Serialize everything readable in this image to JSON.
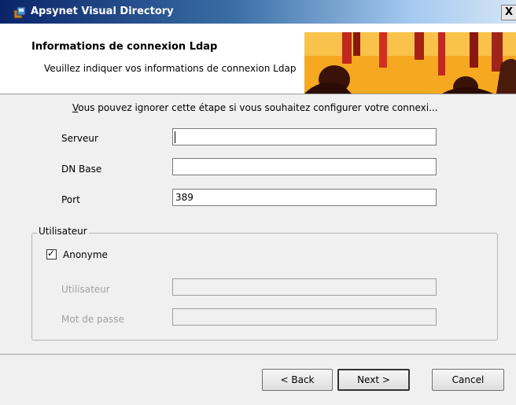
{
  "window": {
    "title": "Apsynet Visual Directory",
    "close_glyph": "X",
    "icon": "installer-icon"
  },
  "header": {
    "title": "Informations de connexion Ldap",
    "subtitle": "Veuillez indiquer vos informations de connexion Ldap"
  },
  "body": {
    "info_first_letter": "V",
    "info_rest": "ous pouvez ignorer cette étape si vous souhaitez configurer votre connexi...",
    "fields": {
      "server": {
        "label": "Serveur",
        "value": ""
      },
      "base_dn": {
        "label": "DN Base",
        "value": ""
      },
      "port": {
        "label": "Port",
        "value": "389"
      }
    },
    "user_group": {
      "legend": "Utilisateur",
      "anonymous": {
        "label": "Anonyme",
        "checked": true
      },
      "username": {
        "label": "Utilisateur",
        "value": "",
        "disabled": true
      },
      "password": {
        "label": "Mot de passe",
        "value": "",
        "disabled": true
      }
    }
  },
  "footer": {
    "back_label": "< Back",
    "next_label": "Next >",
    "cancel_label": "Cancel"
  },
  "colors": {
    "title_bar_start": "#0a246a",
    "title_bar_end": "#d4e4f4",
    "dialog_bg": "#f0f0f0"
  }
}
